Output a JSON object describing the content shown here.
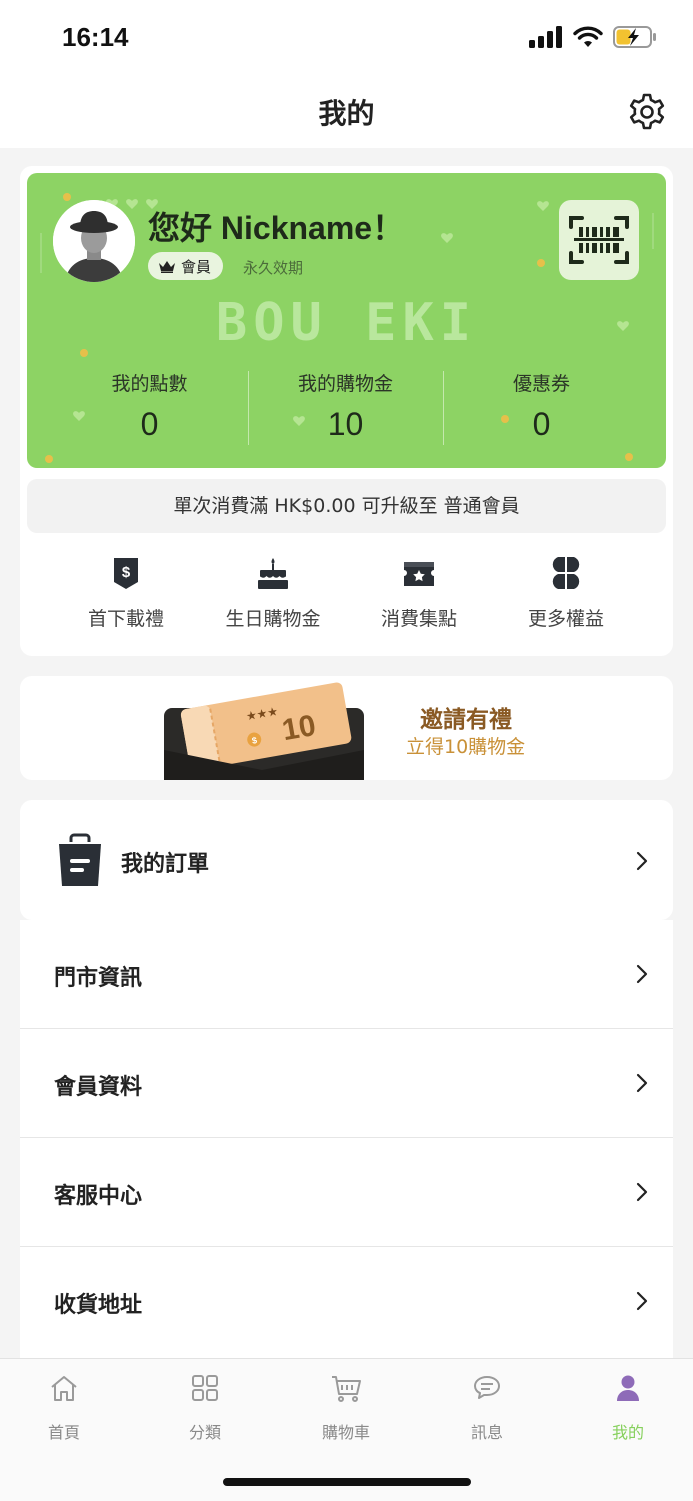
{
  "status_bar": {
    "time": "16:14"
  },
  "header": {
    "title": "我的"
  },
  "member_card": {
    "greeting": "您好 Nickname！",
    "tier_label": "會員",
    "validity": "永久效期",
    "brand": "BOU EKI",
    "stats": [
      {
        "label": "我的點數",
        "value": "0"
      },
      {
        "label": "我的購物金",
        "value": "10"
      },
      {
        "label": "優惠券",
        "value": "0"
      }
    ],
    "accent_color": "#8dd364"
  },
  "upgrade_notice": "單次消費滿 HK$0.00 可升級至 普通會員",
  "benefits": [
    {
      "label": "首下載禮",
      "icon": "dollar-gift-icon"
    },
    {
      "label": "生日購物金",
      "icon": "birthday-cake-icon"
    },
    {
      "label": "消費集點",
      "icon": "star-ticket-icon"
    },
    {
      "label": "更多權益",
      "icon": "clover-grid-icon"
    }
  ],
  "invite_banner": {
    "title": "邀請有禮",
    "subtitle": "立得10購物金",
    "voucher_amount": "10"
  },
  "orders": {
    "label": "我的訂單"
  },
  "menu_items": [
    {
      "label": "門市資訊"
    },
    {
      "label": "會員資料"
    },
    {
      "label": "客服中心"
    },
    {
      "label": "收貨地址"
    }
  ],
  "tabs": [
    {
      "label": "首頁",
      "icon": "home-icon"
    },
    {
      "label": "分類",
      "icon": "category-grid-icon"
    },
    {
      "label": "購物車",
      "icon": "cart-icon"
    },
    {
      "label": "訊息",
      "icon": "message-icon"
    },
    {
      "label": "我的",
      "icon": "user-icon",
      "active": true
    }
  ],
  "colors": {
    "active_tab": "#86d05c",
    "invite_title": "#8a5a24",
    "invite_subtitle": "#c99138"
  }
}
